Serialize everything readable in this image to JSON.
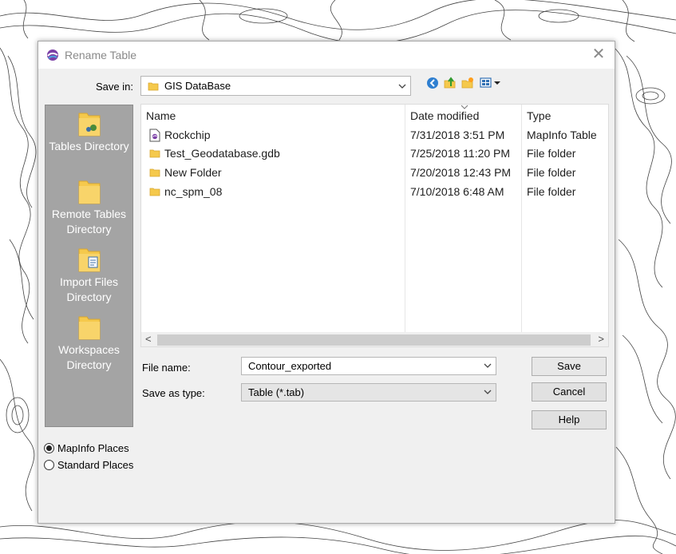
{
  "dialog": {
    "title": "Rename Table",
    "close_glyph": "✕",
    "save_in": {
      "label": "Save in:",
      "value": "GIS DataBase"
    },
    "toolbar": {
      "icons": [
        "back-icon",
        "up-folder-icon",
        "new-folder-icon",
        "view-menu-icon"
      ]
    },
    "places": [
      {
        "label": "Tables Directory",
        "icon": "tables-folder-icon"
      },
      {
        "label": "Remote Tables Directory",
        "icon": "folder-icon"
      },
      {
        "label": "Import Files Directory",
        "icon": "import-folder-icon"
      },
      {
        "label": "Workspaces Directory",
        "icon": "folder-icon"
      }
    ],
    "columns": [
      "Name",
      "Date modified",
      "Type"
    ],
    "files": [
      {
        "name": "Rockchip",
        "date": "7/31/2018 3:51 PM",
        "type": "MapInfo Table",
        "icon": "mapinfo-table-icon"
      },
      {
        "name": "Test_Geodatabase.gdb",
        "date": "7/25/2018 11:20 PM",
        "type": "File folder",
        "icon": "folder-icon"
      },
      {
        "name": "New Folder",
        "date": "7/20/2018 12:43 PM",
        "type": "File folder",
        "icon": "folder-icon"
      },
      {
        "name": "nc_spm_08",
        "date": "7/10/2018 6:48 AM",
        "type": "File folder",
        "icon": "folder-icon"
      }
    ],
    "file_name": {
      "label": "File name:",
      "value": "Contour_exported"
    },
    "save_as_type": {
      "label": "Save as type:",
      "value": "Table (*.tab)"
    },
    "buttons": {
      "save": "Save",
      "cancel": "Cancel",
      "help": "Help"
    },
    "radios": [
      {
        "label": "MapInfo Places",
        "selected": true
      },
      {
        "label": "Standard Places",
        "selected": false
      }
    ],
    "scroll_left": "<",
    "scroll_right": ">",
    "colors": {
      "places_bg": "#a4a4a4",
      "folder_yellow": "#f5c94c",
      "accent": "#0078d7"
    }
  }
}
